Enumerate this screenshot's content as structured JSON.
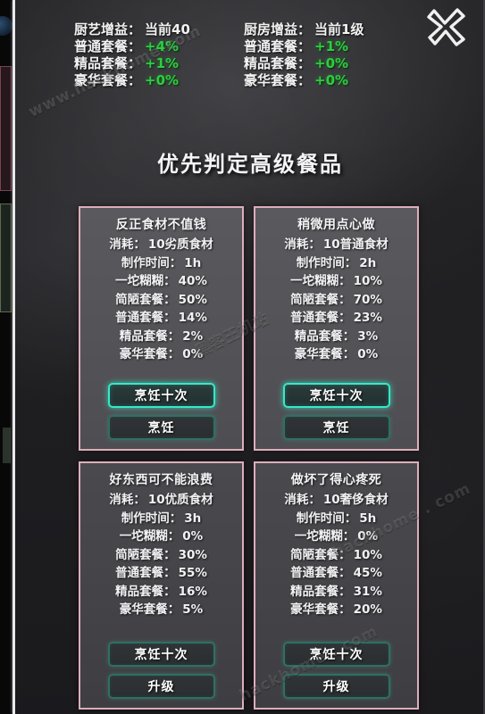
{
  "window": {
    "close_icon": "close-x-icon"
  },
  "header": {
    "buffs": [
      {
        "title_label": "厨艺增益：",
        "title_value": "当前40",
        "rows": [
          {
            "label": "普通套餐：",
            "value": "+4%"
          },
          {
            "label": "精品套餐：",
            "value": "+1%"
          },
          {
            "label": "豪华套餐：",
            "value": "+0%"
          }
        ]
      },
      {
        "title_label": "厨房增益：",
        "title_value": "当前1级",
        "rows": [
          {
            "label": "普通套餐：",
            "value": "+1%"
          },
          {
            "label": "精品套餐：",
            "value": "+0%"
          },
          {
            "label": "豪华套餐：",
            "value": "+0%"
          }
        ]
      }
    ]
  },
  "page_title": "优先判定高级餐品",
  "recipes": [
    {
      "title": "反正食材不值钱",
      "stats": [
        {
          "label": "消耗：",
          "value": "10劣质食材"
        },
        {
          "label": "制作时间：",
          "value": "1h"
        },
        {
          "label": "一坨糊糊：",
          "value": "40%"
        },
        {
          "label": "简陋套餐：",
          "value": "50%"
        },
        {
          "label": "普通套餐：",
          "value": "14%"
        },
        {
          "label": "精品套餐：",
          "value": "2%"
        },
        {
          "label": "豪华套餐：",
          "value": "0%"
        }
      ],
      "buttons": [
        {
          "label": "烹饪十次",
          "style": "primary"
        },
        {
          "label": "烹饪",
          "style": "ghost"
        }
      ]
    },
    {
      "title": "稍微用点心做",
      "stats": [
        {
          "label": "消耗：",
          "value": "10普通食材"
        },
        {
          "label": "制作时间：",
          "value": "2h"
        },
        {
          "label": "一坨糊糊：",
          "value": "10%"
        },
        {
          "label": "简陋套餐：",
          "value": "70%"
        },
        {
          "label": "普通套餐：",
          "value": "23%"
        },
        {
          "label": "精品套餐：",
          "value": "3%"
        },
        {
          "label": "豪华套餐：",
          "value": "0%"
        }
      ],
      "buttons": [
        {
          "label": "烹饪十次",
          "style": "primary"
        },
        {
          "label": "烹饪",
          "style": "ghost"
        }
      ]
    },
    {
      "title": "好东西可不能浪费",
      "stats": [
        {
          "label": "消耗：",
          "value": "10优质食材"
        },
        {
          "label": "制作时间：",
          "value": "3h"
        },
        {
          "label": "一坨糊糊：",
          "value": "0%"
        },
        {
          "label": "简陋套餐：",
          "value": "30%"
        },
        {
          "label": "普通套餐：",
          "value": "55%"
        },
        {
          "label": "精品套餐：",
          "value": "16%"
        },
        {
          "label": "豪华套餐：",
          "value": "5%"
        }
      ],
      "buttons": [
        {
          "label": "烹饪十次",
          "style": "ghost"
        },
        {
          "label": "升级",
          "style": "ghost"
        }
      ]
    },
    {
      "title": "做坏了得心疼死",
      "stats": [
        {
          "label": "消耗：",
          "value": "10奢侈食材"
        },
        {
          "label": "制作时间：",
          "value": "5h"
        },
        {
          "label": "一坨糊糊：",
          "value": "0%"
        },
        {
          "label": "简陋套餐：",
          "value": "10%"
        },
        {
          "label": "普通套餐：",
          "value": "45%"
        },
        {
          "label": "精品套餐：",
          "value": "31%"
        },
        {
          "label": "豪华套餐：",
          "value": "20%"
        }
      ],
      "buttons": [
        {
          "label": "烹饪十次",
          "style": "ghost"
        },
        {
          "label": "升级",
          "style": "ghost"
        }
      ]
    }
  ],
  "watermarks": [
    "www.hackhome.com",
    "黑客王机站",
    "hackhome . com",
    "hackhome . com"
  ],
  "colors": {
    "card_border": "#dcaebb",
    "buff_positive": "#2ecc40",
    "button_active": "#36e8c8",
    "button_ghost": "#2f6f64"
  }
}
